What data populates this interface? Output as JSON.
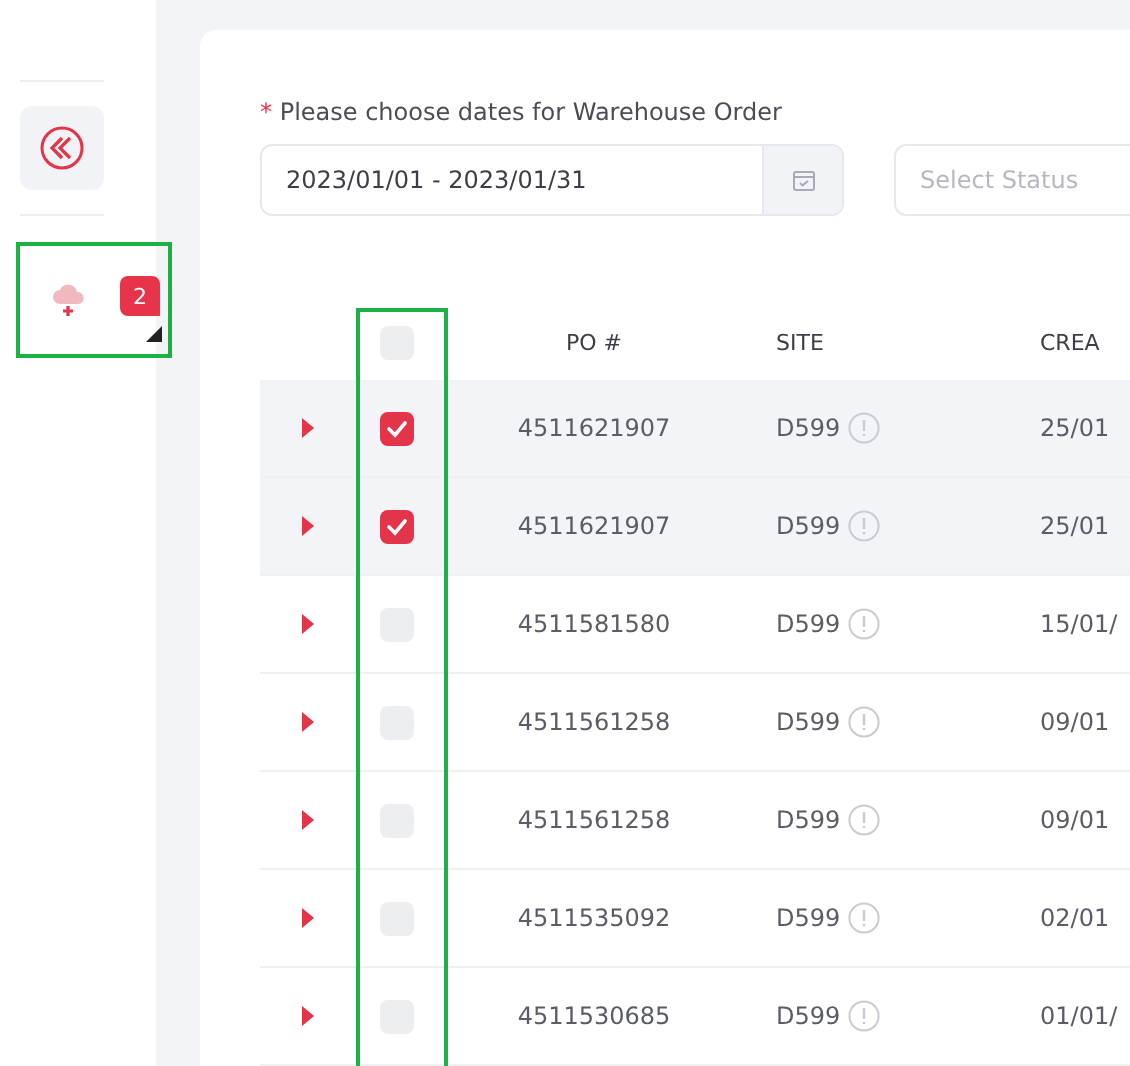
{
  "sidebar": {
    "notification_badge": "2"
  },
  "filter": {
    "label": "Please choose dates for Warehouse Order",
    "required_mark": "*",
    "date_range": "2023/01/01 - 2023/01/31",
    "status_placeholder": "Select Status"
  },
  "table": {
    "select_all_checked": false,
    "columns": [
      "PO #",
      "SITE",
      "CREA"
    ],
    "rows": [
      {
        "checked": true,
        "po": "4511621907",
        "site": "D599",
        "created": "25/01"
      },
      {
        "checked": true,
        "po": "4511621907",
        "site": "D599",
        "created": "25/01"
      },
      {
        "checked": false,
        "po": "4511581580",
        "site": "D599",
        "created": "15/01/"
      },
      {
        "checked": false,
        "po": "4511561258",
        "site": "D599",
        "created": "09/01"
      },
      {
        "checked": false,
        "po": "4511561258",
        "site": "D599",
        "created": "09/01"
      },
      {
        "checked": false,
        "po": "4511535092",
        "site": "D599",
        "created": "02/01"
      },
      {
        "checked": false,
        "po": "4511530685",
        "site": "D599",
        "created": "01/01/"
      }
    ]
  }
}
